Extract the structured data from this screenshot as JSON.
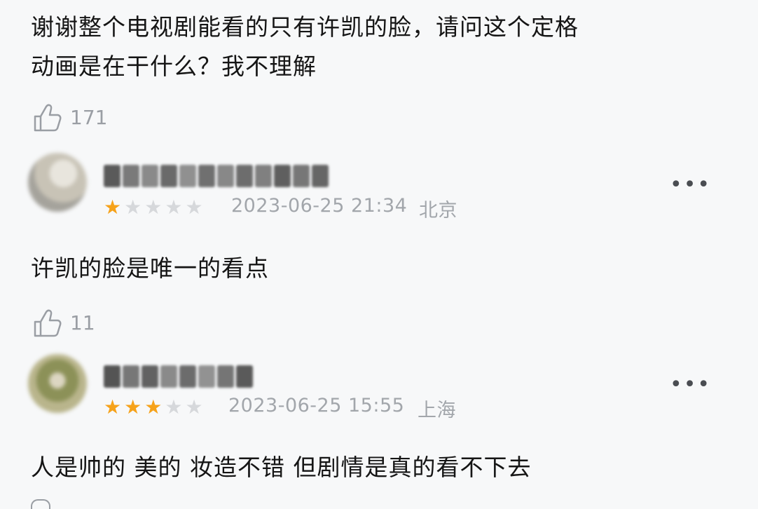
{
  "comment1": {
    "line1": "谢谢整个电视剧能看的只有许凯的脸，请问这个定格",
    "line2": "动画是在干什么？我不理解",
    "likes": "171",
    "like_icon": "thumb-up-icon"
  },
  "reply1": {
    "rating": 1,
    "max_rating": 5,
    "date": "2023-06-25 21:34",
    "location": "北京",
    "text": "许凯的脸是唯一的看点",
    "likes": "11",
    "more_icon": "more-icon",
    "avatar_colors": [
      "#d8d6cf",
      "#c9c5b8",
      "#a8a7a0"
    ],
    "name_colors": [
      "#5a5a5a",
      "#7a7a7a",
      "#8a8a8a",
      "#6a6a6a",
      "#909090",
      "#707070",
      "#888888",
      "#6d6d6d",
      "#808080",
      "#5f5f5f",
      "#777777",
      "#666666"
    ]
  },
  "reply2": {
    "rating": 3,
    "max_rating": 5,
    "date": "2023-06-25 15:55",
    "location": "上海",
    "text": "人是帅的 美的 妆造不错 但剧情是真的看不下去",
    "more_icon": "more-icon",
    "avatar_colors": [
      "#b9b58c",
      "#7e8a55",
      "#d9d3bd"
    ],
    "name_colors": [
      "#545454",
      "#777777",
      "#626262",
      "#8a8a8a",
      "#6c6c6c",
      "#929292",
      "#757575",
      "#5a5a5a"
    ]
  },
  "colors": {
    "background": "#f7f8f9",
    "star_active": "#f6a21a",
    "star_inactive": "#d6d8db",
    "muted_text": "#a2a6ab"
  }
}
